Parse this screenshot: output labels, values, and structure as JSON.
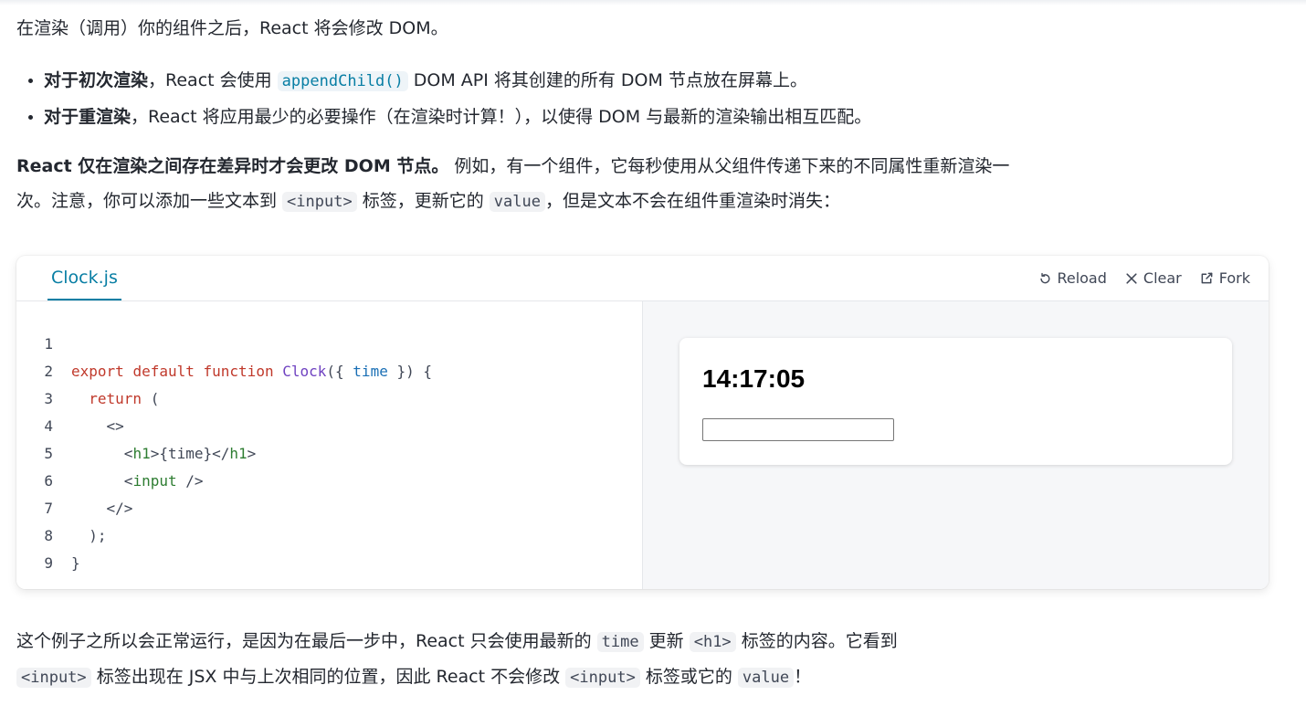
{
  "intro": {
    "text": "在渲染（调用）你的组件之后，React 将会修改 DOM。"
  },
  "bullets": [
    {
      "bold": "对于初次渲染",
      "before": "，React 会使用 ",
      "code": "appendChild()",
      "after": " DOM API 将其创建的所有 DOM 节点放在屏幕上。"
    },
    {
      "bold": "对于重渲染",
      "text": "，React 将应用最少的必要操作（在渲染时计算！），以使得 DOM 与最新的渲染输出相互匹配。"
    }
  ],
  "para2": {
    "bold": "React 仅在渲染之间存在差异时才会更改 DOM 节点。",
    "t1": " 例如，有一个组件，它每秒使用从父组件传递下来的不同属性重新渲染一次。注意，你可以添加一些文本到 ",
    "c1": "<input>",
    "t2": " 标签，更新它的 ",
    "c2": "value",
    "t3": "，但是文本不会在组件重渲染时消失："
  },
  "sandbox": {
    "tab": "Clock.js",
    "actions": {
      "reload": "Reload",
      "clear": "Clear",
      "fork": "Fork"
    },
    "code_lines": [
      {
        "n": "1"
      },
      {
        "n": "2"
      },
      {
        "n": "3"
      },
      {
        "n": "4"
      },
      {
        "n": "5"
      },
      {
        "n": "6"
      },
      {
        "n": "7"
      },
      {
        "n": "8"
      },
      {
        "n": "9"
      }
    ],
    "code": {
      "l1": {
        "export": "export",
        "default": "default",
        "function": "function",
        "name": "Clock",
        "open": "({ ",
        "param": "time",
        "close": " }) {"
      },
      "l2": {
        "return": "return",
        "rest": " ("
      },
      "l3": "<>",
      "l4": {
        "lt": "<",
        "tag": "h1",
        "mid": ">{time}</",
        "tag2": "h1",
        "gt": ">"
      },
      "l5": {
        "lt": "<",
        "tag": "input",
        "end": " />"
      },
      "l6": "</>",
      "l7": ");",
      "l8": "}"
    },
    "preview": {
      "time": "14:17:05",
      "input_value": ""
    }
  },
  "para3": {
    "t1": "这个例子之所以会正常运行，是因为在最后一步中，React 只会使用最新的 ",
    "c1": "time",
    "t2": " 更新 ",
    "c2": "<h1>",
    "t3": " 标签的内容。它看到",
    "c3": "<input>",
    "t4": " 标签出现在 JSX 中与上次相同的位置，因此 React 不会修改 ",
    "c4": "<input>",
    "t5": " 标签或它的 ",
    "c5": "value",
    "t6": "！"
  }
}
